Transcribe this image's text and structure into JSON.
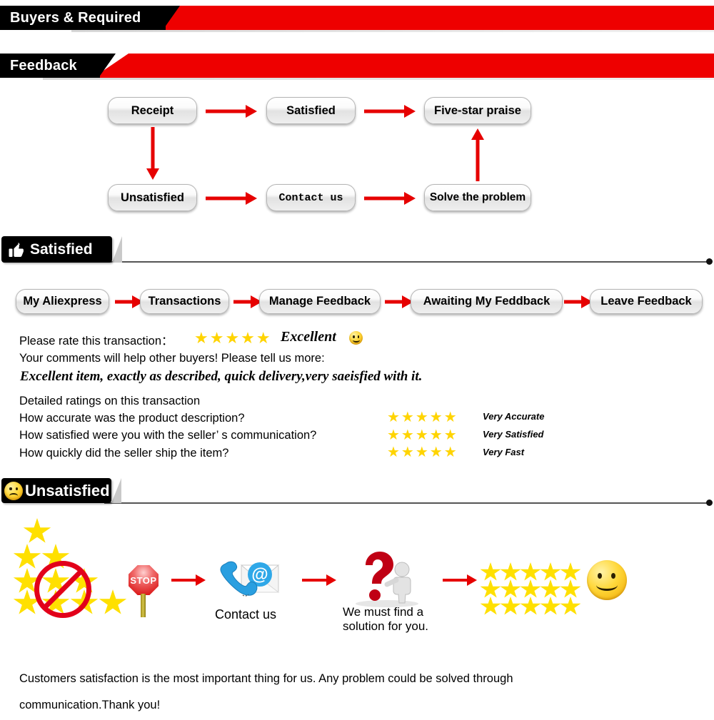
{
  "banners": [
    {
      "id": "buyers-required",
      "label": "Buyers & Required"
    },
    {
      "id": "feedback",
      "label": "Feedback"
    }
  ],
  "colors": {
    "red": "#ee0000",
    "arrow_red": "#e60000",
    "star_yellow": "#ffd400",
    "black": "#000000",
    "rule_gray": "#555555"
  },
  "flowchart": {
    "nodes": [
      {
        "id": "receipt",
        "label": "Receipt"
      },
      {
        "id": "satisfied",
        "label": "Satisfied"
      },
      {
        "id": "five-star-praise",
        "label": "Five-star praise"
      },
      {
        "id": "unsatisfied",
        "label": "Unsatisfied"
      },
      {
        "id": "contact-us",
        "label": "Contact us"
      },
      {
        "id": "solve-the-problem",
        "label": "Solve the problem"
      }
    ]
  },
  "satisfied_section": {
    "plate_label": "Satisfied",
    "plate_icon": "thumbs-up-icon",
    "breadcrumb": [
      {
        "label": "My Aliexpress"
      },
      {
        "label": "Transactions"
      },
      {
        "label": "Manage Feedback"
      },
      {
        "label": "Awaiting My Feddback"
      },
      {
        "label": "Leave Feedback"
      }
    ],
    "rate_prompt": "Please rate this transaction：",
    "rate_stars": "★★★★★",
    "rate_word": "Excellent",
    "rate_face": "smiley-face-icon",
    "comments_prompt": "Your comments will help other buyers! Please tell us more:",
    "comment_text": "Excellent item, exactly as described, quick delivery,very saeisfied with it.",
    "detail_heading": "Detailed ratings on this transaction",
    "detail_rows": [
      {
        "question": "How accurate was the product description?",
        "stars": "★★★★★",
        "rating": "Very Accurate"
      },
      {
        "question": "How satisfied were you with the seller’ s communication?",
        "stars": "★★★★★",
        "rating": "Very Satisfied"
      },
      {
        "question": "How quickly did the seller ship the item?",
        "stars": "★★★★★",
        "rating": "Very Fast"
      }
    ]
  },
  "unsatisfied_section": {
    "plate_label": "Unsatisfied",
    "plate_icon": "sad-face-icon",
    "steps": [
      {
        "id": "bad-rating",
        "icon": "crossed-out-stars-icon",
        "caption": ""
      },
      {
        "id": "stop",
        "icon": "stop-sign-icon",
        "label": "STOP",
        "caption": ""
      },
      {
        "id": "contact",
        "icon": "phone-email-icon",
        "caption": "Contact us"
      },
      {
        "id": "solution",
        "icon": "question-mark-person-icon",
        "caption": "We must find a solution for you."
      },
      {
        "id": "good-rating",
        "icon": "star-grid-icon",
        "caption": ""
      },
      {
        "id": "happy",
        "icon": "smiley-face-icon",
        "caption": ""
      }
    ]
  },
  "footer": {
    "line1": "Customers satisfaction is the most important thing for us. Any problem could be solved through",
    "line2": "communication.Thank you!"
  }
}
